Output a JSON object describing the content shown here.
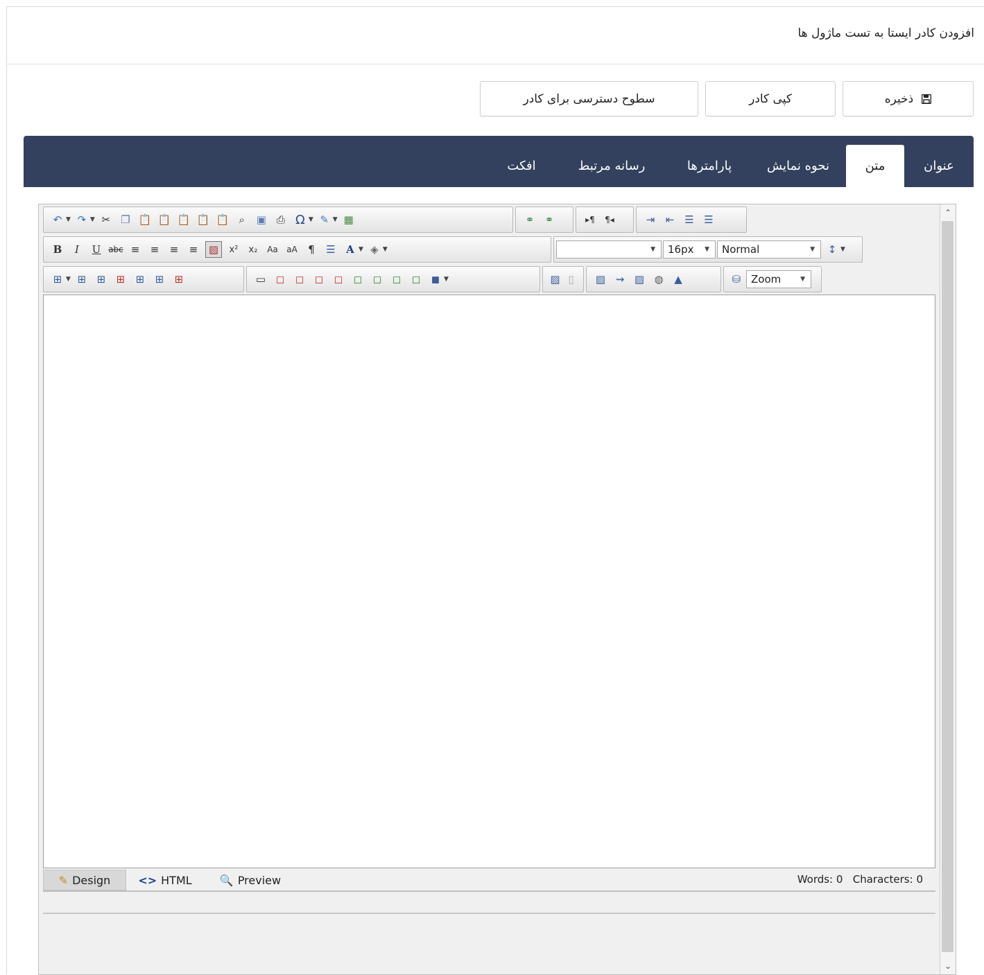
{
  "header": {
    "title": "افزودن کادر ایستا به تست ماژول ها"
  },
  "actions": {
    "save_label": "ذخیره",
    "copy_label": "کپی کادر",
    "access_label": "سطوح دسترسی برای کادر"
  },
  "tabs": [
    {
      "label": "عنوان",
      "active": false
    },
    {
      "label": "متن",
      "active": true
    },
    {
      "label": "نحوه نمایش",
      "active": false
    },
    {
      "label": "پارامترها",
      "active": false
    },
    {
      "label": "رسانه مرتبط",
      "active": false
    },
    {
      "label": "افکت",
      "active": false
    }
  ],
  "editor": {
    "font_size_value": "16px",
    "format_value": "Normal",
    "zoom_value": "Zoom",
    "modes": {
      "design": "Design",
      "html": "HTML",
      "preview": "Preview"
    },
    "words": "Words: 0",
    "characters": "Characters: 0"
  },
  "colors": {
    "tab_bar": "#33415e",
    "page_bg": "#ffffff"
  }
}
